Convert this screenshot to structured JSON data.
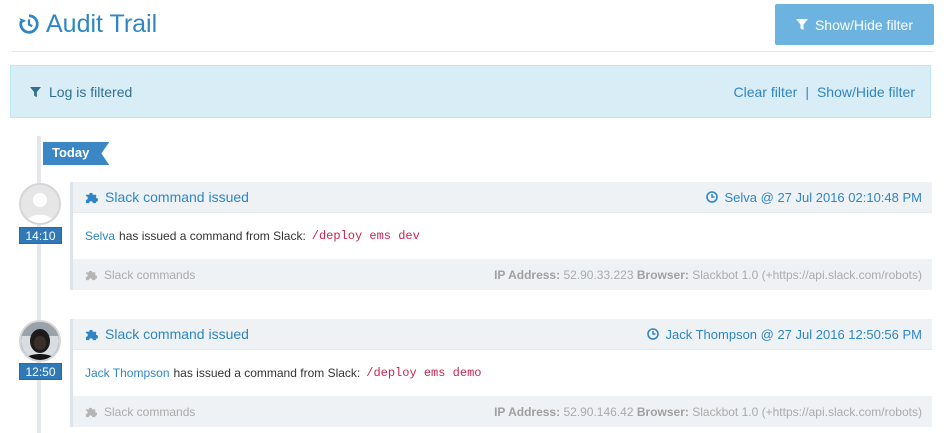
{
  "header": {
    "title": "Audit Trail",
    "toggle_label": "Show/Hide filter"
  },
  "filter_alert": {
    "message": "Log is filtered",
    "clear_label": "Clear filter",
    "separator": "|",
    "toggle_label": "Show/Hide filter"
  },
  "timeline": {
    "day_label": "Today",
    "entries": [
      {
        "time": "14:10",
        "title": "Slack command issued",
        "meta": "Selva @ 27 Jul 2016 02:10:48 PM",
        "user": "Selva",
        "action": "has issued a command from Slack:",
        "command": "/deploy ems dev",
        "category": "Slack commands",
        "ip_label": "IP Address:",
        "ip": "52.90.33.223",
        "browser_label": "Browser:",
        "browser": "Slackbot 1.0 (+https://api.slack.com/robots)"
      },
      {
        "time": "12:50",
        "title": "Slack command issued",
        "meta": "Jack Thompson @ 27 Jul 2016 12:50:56 PM",
        "user": "Jack Thompson",
        "action": "has issued a command from Slack:",
        "command": "/deploy ems demo",
        "category": "Slack commands",
        "ip_label": "IP Address:",
        "ip": "52.90.146.42",
        "browser_label": "Browser:",
        "browser": "Slackbot 1.0 (+https://api.slack.com/robots)"
      }
    ]
  },
  "colors": {
    "accent": "#2f86c4",
    "button": "#6cb3e0",
    "alert_bg": "#d9edf7",
    "badge": "#3179b6",
    "command": "#c7254e"
  }
}
